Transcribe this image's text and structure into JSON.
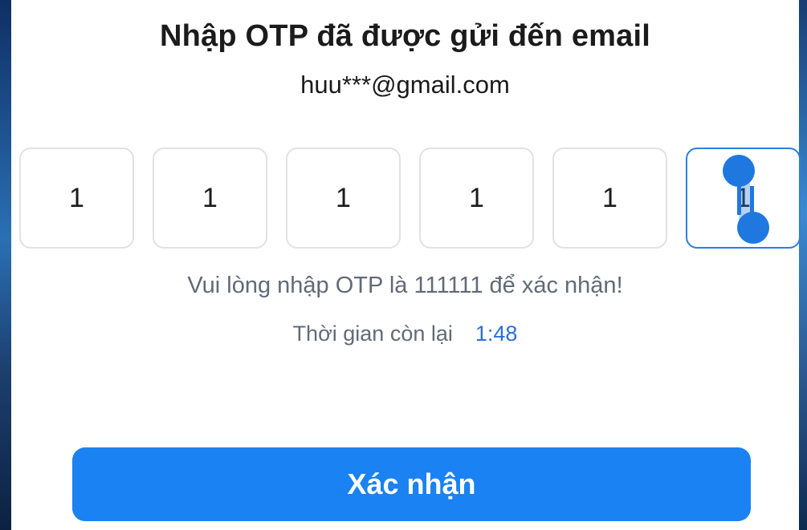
{
  "header": {
    "title": "Nhập OTP đã được gửi đến email",
    "email": "huu***@gmail.com"
  },
  "otp": {
    "digits": [
      "1",
      "1",
      "1",
      "1",
      "1",
      "1"
    ],
    "active_index": 5
  },
  "hint": "Vui lòng nhập OTP là 111111 để xác nhận!",
  "timer": {
    "label": "Thời gian còn lại",
    "value": "1:48"
  },
  "confirm_button": {
    "label": "Xác nhận"
  },
  "colors": {
    "accent": "#1a82f2",
    "active_border": "#2a7fe3",
    "timer": "#2a6fdb",
    "hint_text": "#626a78"
  }
}
